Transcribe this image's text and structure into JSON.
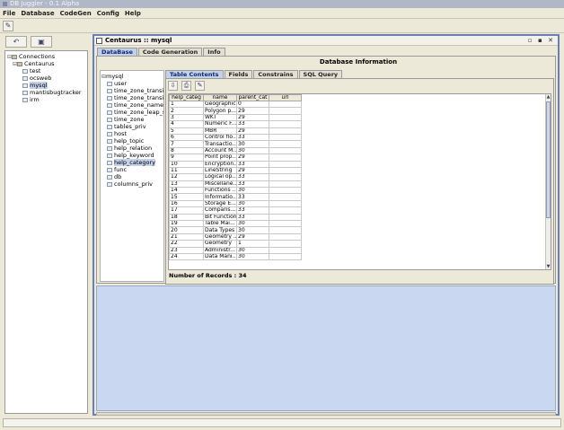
{
  "window": {
    "title": "DB Juggler - 0.1 Alpha"
  },
  "menu": [
    "File",
    "Database",
    "CodeGen",
    "Config",
    "Help"
  ],
  "toolbar": {
    "connect_icon": "pencil-icon",
    "connect_glyph": "✎"
  },
  "left_panel": {
    "btn1_glyph": "↶",
    "btn2_glyph": "▣",
    "tree": {
      "root": "Connections",
      "server": "Centaurus",
      "databases": [
        "test",
        "ocsweb",
        "mysql",
        "mantisbugtracker",
        "irm"
      ],
      "selected_index": 2
    }
  },
  "inner_window": {
    "title": "Centaurus :: mysql",
    "controls": "▫ ▪ ✕",
    "tabs": [
      "DataBase",
      "Code Generation",
      "Info"
    ],
    "active_tab": 0
  },
  "db_panel": {
    "title": "Database Information",
    "tree_root": "mysql",
    "tables": [
      "user",
      "time_zone_transiti",
      "time_zone_transiti",
      "time_zone_name",
      "time_zone_leap_se",
      "time_zone",
      "tables_priv",
      "host",
      "help_topic",
      "help_relation",
      "help_keyword",
      "help_category",
      "func",
      "db",
      "columns_priv"
    ],
    "selected_table_index": 11,
    "sub_tabs": [
      "Table Contents",
      "Fields",
      "Constrains",
      "SQL Query"
    ],
    "active_sub_tab": 0,
    "tools": [
      "⇩",
      "⎙",
      "✎"
    ]
  },
  "table": {
    "columns": [
      "help_categ",
      "name",
      "parent_cat",
      "url"
    ],
    "rows": [
      [
        "1",
        "Geographic",
        "0",
        ""
      ],
      [
        "2",
        "Polygon p...",
        "29",
        ""
      ],
      [
        "3",
        "WKT",
        "29",
        ""
      ],
      [
        "4",
        "Numeric F...",
        "33",
        ""
      ],
      [
        "5",
        "MBR",
        "29",
        ""
      ],
      [
        "6",
        "Control flo...",
        "33",
        ""
      ],
      [
        "7",
        "Transactio...",
        "30",
        ""
      ],
      [
        "8",
        "Account M...",
        "30",
        ""
      ],
      [
        "9",
        "Point prop...",
        "29",
        ""
      ],
      [
        "10",
        "Encryption...",
        "33",
        ""
      ],
      [
        "11",
        "LineString",
        "29",
        ""
      ],
      [
        "12",
        "Logical op...",
        "33",
        ""
      ],
      [
        "13",
        "Miscellane...",
        "33",
        ""
      ],
      [
        "14",
        "Functions ...",
        "30",
        ""
      ],
      [
        "15",
        "Informatio...",
        "33",
        ""
      ],
      [
        "16",
        "Storage E...",
        "30",
        ""
      ],
      [
        "17",
        "Comparis...",
        "33",
        ""
      ],
      [
        "18",
        "Bit Functions",
        "33",
        ""
      ],
      [
        "19",
        "Table Mai...",
        "30",
        ""
      ],
      [
        "20",
        "Data Types",
        "30",
        ""
      ],
      [
        "21",
        "Geometry ...",
        "29",
        ""
      ],
      [
        "22",
        "Geometry",
        "1",
        ""
      ],
      [
        "23",
        "Administr...",
        "30",
        ""
      ],
      [
        "24",
        "Data Mani...",
        "30",
        ""
      ]
    ],
    "record_count": "Number of Records : 34"
  }
}
